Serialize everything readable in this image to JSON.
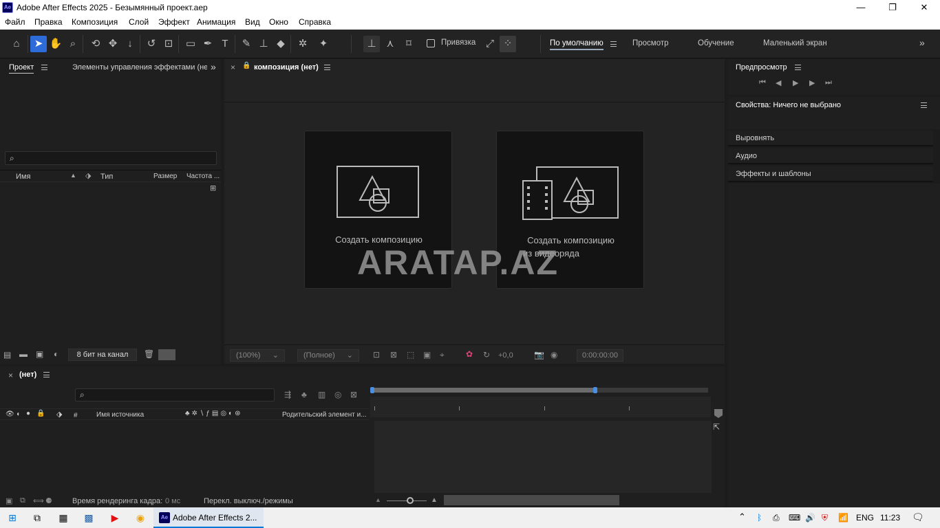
{
  "window": {
    "app_icon": "Ae",
    "title": "Adobe After Effects 2025 - Безымянный проект.aep",
    "minimize": "—",
    "maximize": "❐",
    "close": "✕"
  },
  "menu": [
    "Файл",
    "Правка",
    "Композиция",
    "Слой",
    "Эффект",
    "Анимация",
    "Вид",
    "Окно",
    "Справка"
  ],
  "toolbar": {
    "snap_label": "Привязка",
    "workspaces": [
      "По умолчанию",
      "Просмотр",
      "Обучение",
      "Маленький экран"
    ],
    "active_workspace": "По умолчанию",
    "overflow": "»"
  },
  "project_panel": {
    "tab_project": "Проект",
    "tab_effects": "Элементы управления эффектами (нет)",
    "overflow": "»",
    "search_icon": "⌕",
    "columns": [
      "Имя",
      "Тип",
      "Размер",
      "Частота ..."
    ],
    "bit_depth": "8 бит на канал"
  },
  "composition_panel": {
    "tab_title": "композиция (нет)",
    "close": "×",
    "card_new": "Создать композицию",
    "card_footage_line1": "Создать композицию",
    "card_footage_line2": "из видеоряда",
    "zoom": "(100%)",
    "resolution": "(Полное)",
    "exposure": "+0,0",
    "timecode": "0:00:00:00"
  },
  "watermark": "ARATAP.AZ",
  "right_panels": {
    "preview": "Предпросмотр",
    "properties": "Свойства: Ничего не выбрано",
    "align": "Выровнять",
    "audio": "Аудио",
    "effects": "Эффекты и шаблоны"
  },
  "timeline": {
    "tab": "(нет)",
    "close": "×",
    "col_hash": "#",
    "col_source": "Имя источника",
    "col_parent": "Родительский элемент и...",
    "render_time": "Время рендеринга кадра:",
    "render_value": "0 мс",
    "toggle_modes": "Перекл. выключ./режимы"
  },
  "taskbar": {
    "app_label": "Adobe After Effects 2...",
    "lang": "ENG",
    "time": "11:23"
  },
  "colors": {
    "accent": "#2d6bd8",
    "panel_bg": "#1f1f1f",
    "card_bg": "#131313",
    "timeline_marker": "#4a90e2"
  }
}
